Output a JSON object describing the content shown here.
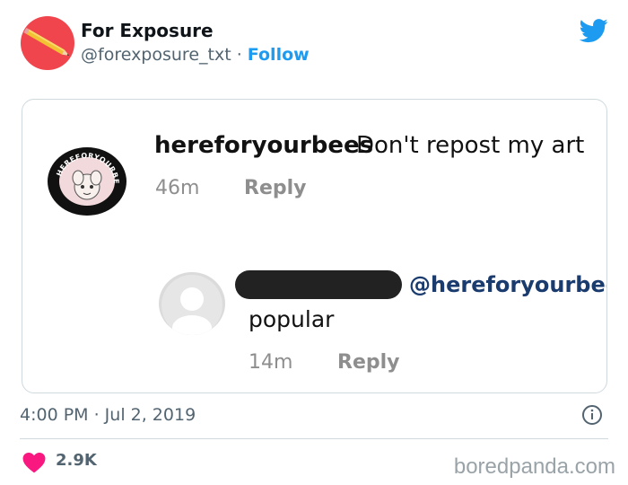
{
  "tweet": {
    "display_name": "For Exposure",
    "handle": "@forexposure_txt",
    "separator": " · ",
    "follow_label": "Follow",
    "timestamp": "4:00 PM · Jul 2, 2019",
    "likes": "2.9K"
  },
  "embedded": {
    "comment1": {
      "username": "hereforyourbees",
      "text": "Don't repost my art",
      "time": "46m",
      "reply_label": "Reply",
      "avatar_text": "HEREFORYOURBEES"
    },
    "comment2": {
      "mention": "@hereforyourbee",
      "text": "popular",
      "time": "14m",
      "reply_label": "Reply"
    }
  },
  "watermark": "boredpanda.com",
  "icons": {
    "twitter": "twitter-bird-icon",
    "info": "info-icon",
    "heart": "heart-icon"
  },
  "colors": {
    "accent": "#1d9bf0",
    "avatar_bg": "#f0454c",
    "heart": "#f91880"
  }
}
